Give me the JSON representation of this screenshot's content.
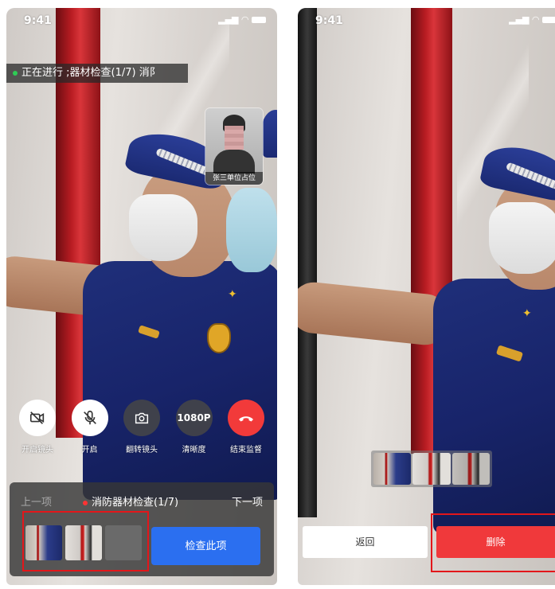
{
  "left_screen": {
    "status": {
      "time": "9:41"
    },
    "progress_banner": "正在进行 ;器材检查(1/7) 消阝",
    "pip": {
      "label": "张三单位占位"
    },
    "controls": [
      {
        "label": "开启镜头",
        "icon": "camera-off-icon"
      },
      {
        "label": "开启",
        "icon": "mic-off-icon"
      },
      {
        "label": "翻转镜头",
        "icon": "flip-camera-icon"
      },
      {
        "label": "清晰度",
        "value": "1080P"
      },
      {
        "label": "结束监督",
        "icon": "hang-up-icon"
      }
    ],
    "panel": {
      "prev": "上一项",
      "current": "消防器材检查(1/7)",
      "next": "下一项",
      "check_button": "检查此项"
    }
  },
  "right_screen": {
    "status": {
      "time": "9:41"
    },
    "back_button": "返回",
    "delete_button": "删除"
  },
  "colors": {
    "primary_blue": "#2b6ff0",
    "danger_red": "#f0393b",
    "highlight_red": "#e3161a",
    "status_green": "#2ecc55"
  }
}
